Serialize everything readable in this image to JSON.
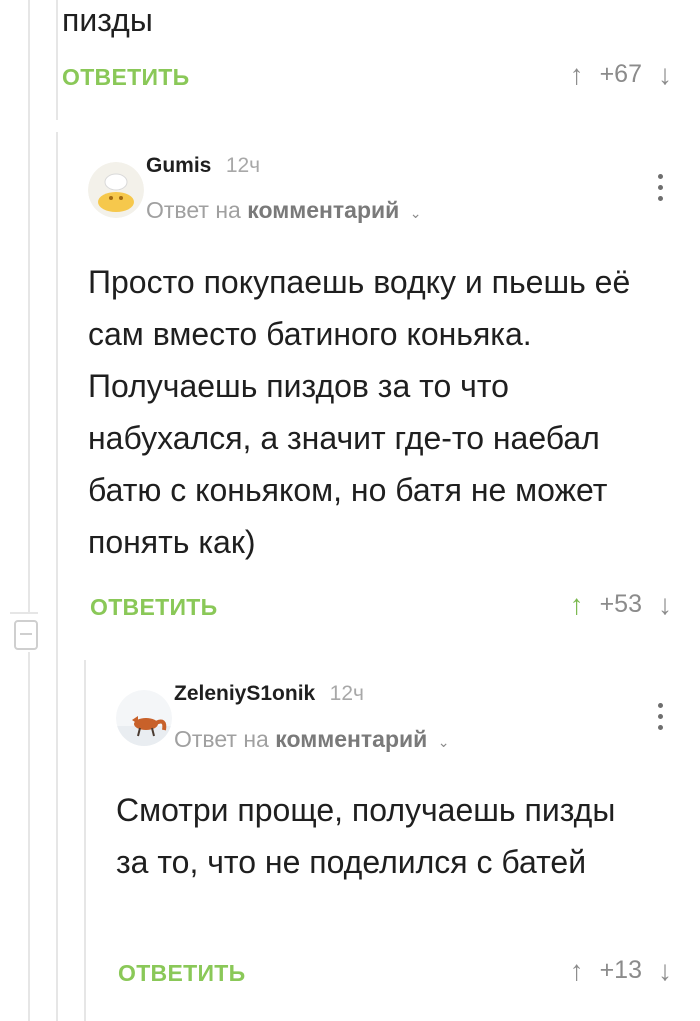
{
  "top_comment": {
    "text_tail": "пизды",
    "reply_label": "ОТВЕТИТЬ",
    "score": "+67"
  },
  "comment_1": {
    "username": "Gumis",
    "time": "12ч",
    "reply_prefix": "Ответ на",
    "reply_link": "комментарий",
    "text": "Просто покупаешь водку и пьешь её сам вместо батиного коньяка. Получаешь пиздов за то что набухался, а значит где-то наебал батю с коньяком, но батя не может понять как)",
    "reply_label": "ОТВЕТИТЬ",
    "score": "+53"
  },
  "comment_2": {
    "username": "ZeleniyS1onik",
    "time": "12ч",
    "reply_prefix": "Ответ на",
    "reply_link": "комментарий",
    "text": "Смотри проще, получаешь пизды за то, что не поделился с батей",
    "reply_label": "ОТВЕТИТЬ",
    "score": "+13"
  },
  "icons": {
    "upvote": "arrow-up",
    "downvote": "arrow-down",
    "more": "kebab-vertical",
    "collapse": "minus-box",
    "reply_dropdown": "chevron-down"
  },
  "colors": {
    "accent_green": "#8ac858",
    "thread_line": "#e6e6e6",
    "muted_text": "#a0a0a0"
  }
}
